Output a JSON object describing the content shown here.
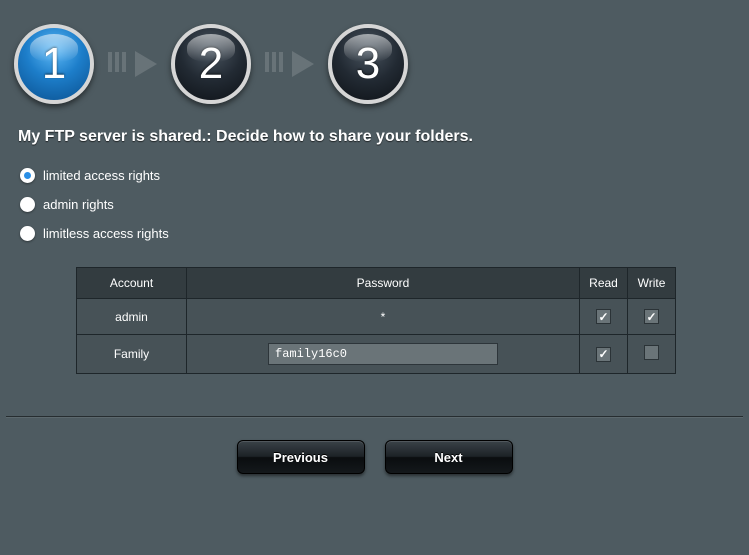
{
  "steps": {
    "s1": "1",
    "s2": "2",
    "s3": "3"
  },
  "heading": "My FTP server is shared.: Decide how to share your folders.",
  "options": {
    "limited": "limited access rights",
    "admin": "admin rights",
    "limitless": "limitless access rights",
    "selected": "limited"
  },
  "table": {
    "headers": {
      "account": "Account",
      "password": "Password",
      "read": "Read",
      "write": "Write"
    },
    "rows": [
      {
        "account": "admin",
        "password_display": "*",
        "password_editable": false,
        "read": true,
        "write": true
      },
      {
        "account": "Family",
        "password_display": "family16c0",
        "password_editable": true,
        "read": true,
        "write": false
      }
    ]
  },
  "buttons": {
    "previous": "Previous",
    "next": "Next"
  }
}
